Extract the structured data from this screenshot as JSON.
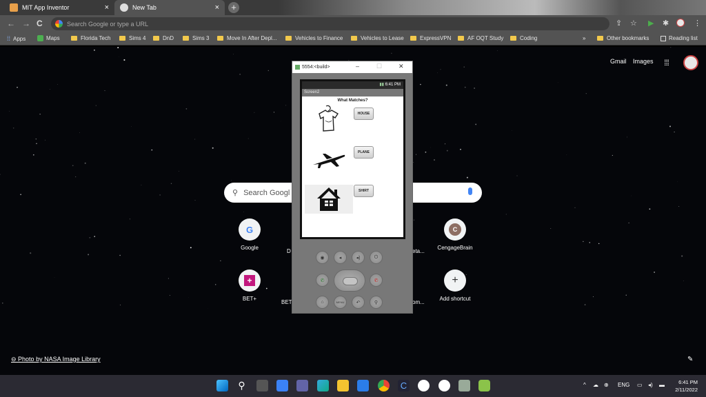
{
  "browser": {
    "tabs": [
      {
        "title": "MIT App Inventor",
        "close": "×",
        "color": "#e8a04a"
      },
      {
        "title": "New Tab",
        "close": "×",
        "color": "#dddddd"
      }
    ],
    "new_tab": "+",
    "omnibox_placeholder": "Search Google or type a URL",
    "nav": {
      "back": "←",
      "forward": "→",
      "reload": "C"
    },
    "toolbar_icons": {
      "share": "⇪",
      "star": "☆",
      "play": "▶",
      "extensions": "✱",
      "menu": "⋮"
    }
  },
  "bookmarks": {
    "apps": "Apps",
    "maps": "Maps",
    "items": [
      "Florida Tech",
      "Sims 4",
      "DnD",
      "Sims 3",
      "Move In After Depl...",
      "Vehicles to Finance",
      "Vehicles to Lease",
      "ExpressVPN",
      "AF OQT Study",
      "Coding"
    ],
    "overflow": "»",
    "other": "Other bookmarks",
    "reading": "Reading list"
  },
  "ntp": {
    "gmail": "Gmail",
    "images": "Images",
    "search_placeholder": "Search Googl",
    "shortcuts": [
      {
        "label": "Google",
        "icon": "G"
      },
      {
        "label": "CengageBrain",
        "icon": "C"
      },
      {
        "label": "BET+",
        "icon": "+"
      },
      {
        "label": "Add shortcut",
        "icon": "+"
      }
    ],
    "partial_labels": [
      "D",
      "eta...",
      "BET",
      "om..."
    ],
    "credit": "Photo by NASA Image Library"
  },
  "emulator": {
    "window_title": "5554:<build>",
    "controls": {
      "minimize": "–",
      "maximize": "☐",
      "close": "✕"
    },
    "status_time": "6:41 PM",
    "screen_name": "Screen2",
    "question": "What Matches?",
    "buttons": [
      "HOUSE",
      "PLANE",
      "SHIRT"
    ],
    "hw_menu": "MENU"
  },
  "taskbar": {
    "tray_lang": "ENG",
    "time": "6:41 PM",
    "date": "2/11/2022",
    "tray_caret": "^"
  }
}
